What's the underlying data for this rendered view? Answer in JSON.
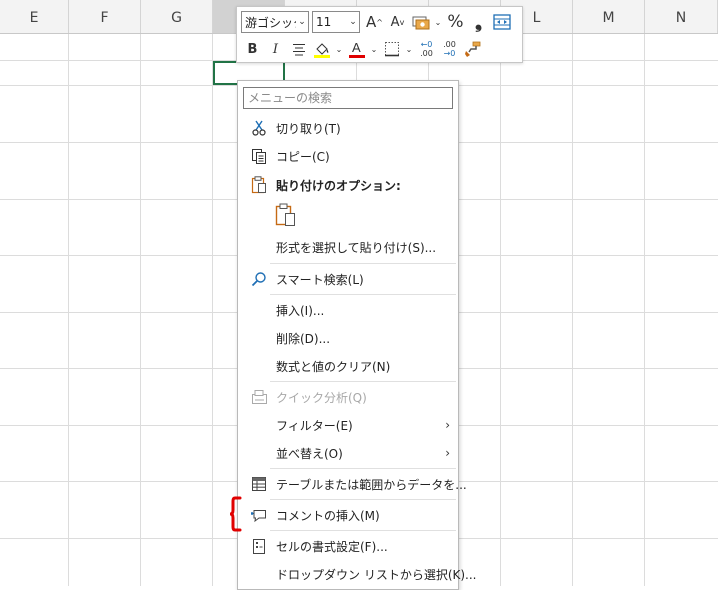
{
  "columns": [
    {
      "label": "E",
      "selected": false
    },
    {
      "label": "F",
      "selected": false
    },
    {
      "label": "G",
      "selected": false
    },
    {
      "label": "",
      "selected": true
    },
    {
      "label": "",
      "selected": false
    },
    {
      "label": "",
      "selected": false
    },
    {
      "label": "",
      "selected": false
    },
    {
      "label": "L",
      "selected": false
    },
    {
      "label": "M",
      "selected": false
    },
    {
      "label": "N",
      "selected": false
    }
  ],
  "mini_toolbar": {
    "font_name": "游ゴシック",
    "font_size": "11",
    "grow_font_glyph": "A",
    "shrink_font_glyph": "A",
    "percent_glyph": "%",
    "comma_glyph": "❟",
    "bold_label": "B",
    "italic_label": "I",
    "increase_decimal_top": "←0",
    "increase_decimal_bottom": ".00",
    "decrease_decimal_top": ".00",
    "decrease_decimal_bottom": "→0",
    "highlight_color": "#ffff00",
    "font_color": "#e00000"
  },
  "context_menu": {
    "search_placeholder": "メニューの検索",
    "items": {
      "cut": "切り取り(T)",
      "copy": "コピー(C)",
      "paste_options": "貼り付けのオプション:",
      "paste_special": "形式を選択して貼り付け(S)...",
      "smart_lookup": "スマート検索(L)",
      "insert": "挿入(I)...",
      "delete": "削除(D)...",
      "clear_contents": "数式と値のクリア(N)",
      "quick_analysis": "クイック分析(Q)",
      "filter": "フィルター(E)",
      "sort": "並べ替え(O)",
      "table_from_range": "テーブルまたは範囲からデータを...",
      "insert_comment": "コメントの挿入(M)",
      "format_cells": "セルの書式設定(F)...",
      "pick_from_dropdown": "ドロップダウン リストから選択(K)..."
    },
    "submenu_arrow": "›"
  },
  "colors": {
    "accent_green": "#217346",
    "highlight_red": "#e00000",
    "paste_orange": "#c56a14"
  }
}
